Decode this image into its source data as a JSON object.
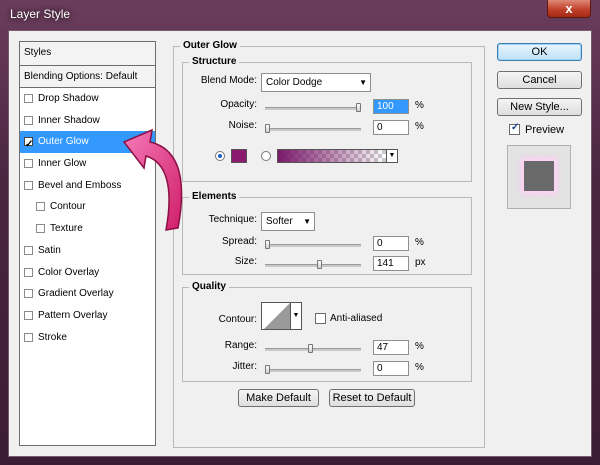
{
  "window": {
    "title": "Layer Style",
    "close_label": "x"
  },
  "styles_panel": {
    "header": "Styles",
    "blending_options": "Blending Options: Default",
    "items": [
      {
        "label": "Drop Shadow",
        "checked": false,
        "sub": false,
        "active": false
      },
      {
        "label": "Inner Shadow",
        "checked": false,
        "sub": false,
        "active": false
      },
      {
        "label": "Outer Glow",
        "checked": true,
        "sub": false,
        "active": true
      },
      {
        "label": "Inner Glow",
        "checked": false,
        "sub": false,
        "active": false
      },
      {
        "label": "Bevel and Emboss",
        "checked": false,
        "sub": false,
        "active": false
      },
      {
        "label": "Contour",
        "checked": false,
        "sub": true,
        "active": false
      },
      {
        "label": "Texture",
        "checked": false,
        "sub": true,
        "active": false
      },
      {
        "label": "Satin",
        "checked": false,
        "sub": false,
        "active": false
      },
      {
        "label": "Color Overlay",
        "checked": false,
        "sub": false,
        "active": false
      },
      {
        "label": "Gradient Overlay",
        "checked": false,
        "sub": false,
        "active": false
      },
      {
        "label": "Pattern Overlay",
        "checked": false,
        "sub": false,
        "active": false
      },
      {
        "label": "Stroke",
        "checked": false,
        "sub": false,
        "active": false
      }
    ]
  },
  "outer_glow": {
    "title": "Outer Glow",
    "structure": {
      "title": "Structure",
      "blend_mode_label": "Blend Mode:",
      "blend_mode_value": "Color Dodge",
      "opacity_label": "Opacity:",
      "opacity_value": "100",
      "opacity_fraction": 1.0,
      "noise_label": "Noise:",
      "noise_value": "0",
      "noise_fraction": 0.0,
      "unit": "%",
      "glow_color": "#8a1a6e"
    },
    "elements": {
      "title": "Elements",
      "technique_label": "Technique:",
      "technique_value": "Softer",
      "spread_label": "Spread:",
      "spread_value": "0",
      "spread_unit": "%",
      "spread_fraction": 0.0,
      "size_label": "Size:",
      "size_value": "141",
      "size_unit": "px",
      "size_fraction": 0.57
    },
    "quality": {
      "title": "Quality",
      "contour_label": "Contour:",
      "antialiased_label": "Anti-aliased",
      "range_label": "Range:",
      "range_value": "47",
      "range_fraction": 0.47,
      "jitter_label": "Jitter:",
      "jitter_value": "0",
      "jitter_fraction": 0.0,
      "unit": "%"
    },
    "make_default": "Make Default",
    "reset_default": "Reset to Default"
  },
  "actions": {
    "ok": "OK",
    "cancel": "Cancel",
    "new_style": "New Style...",
    "preview_label": "Preview",
    "preview_checked": true
  },
  "colors": {
    "accent_selection": "#3399ff",
    "arrow": "#e8367f"
  }
}
